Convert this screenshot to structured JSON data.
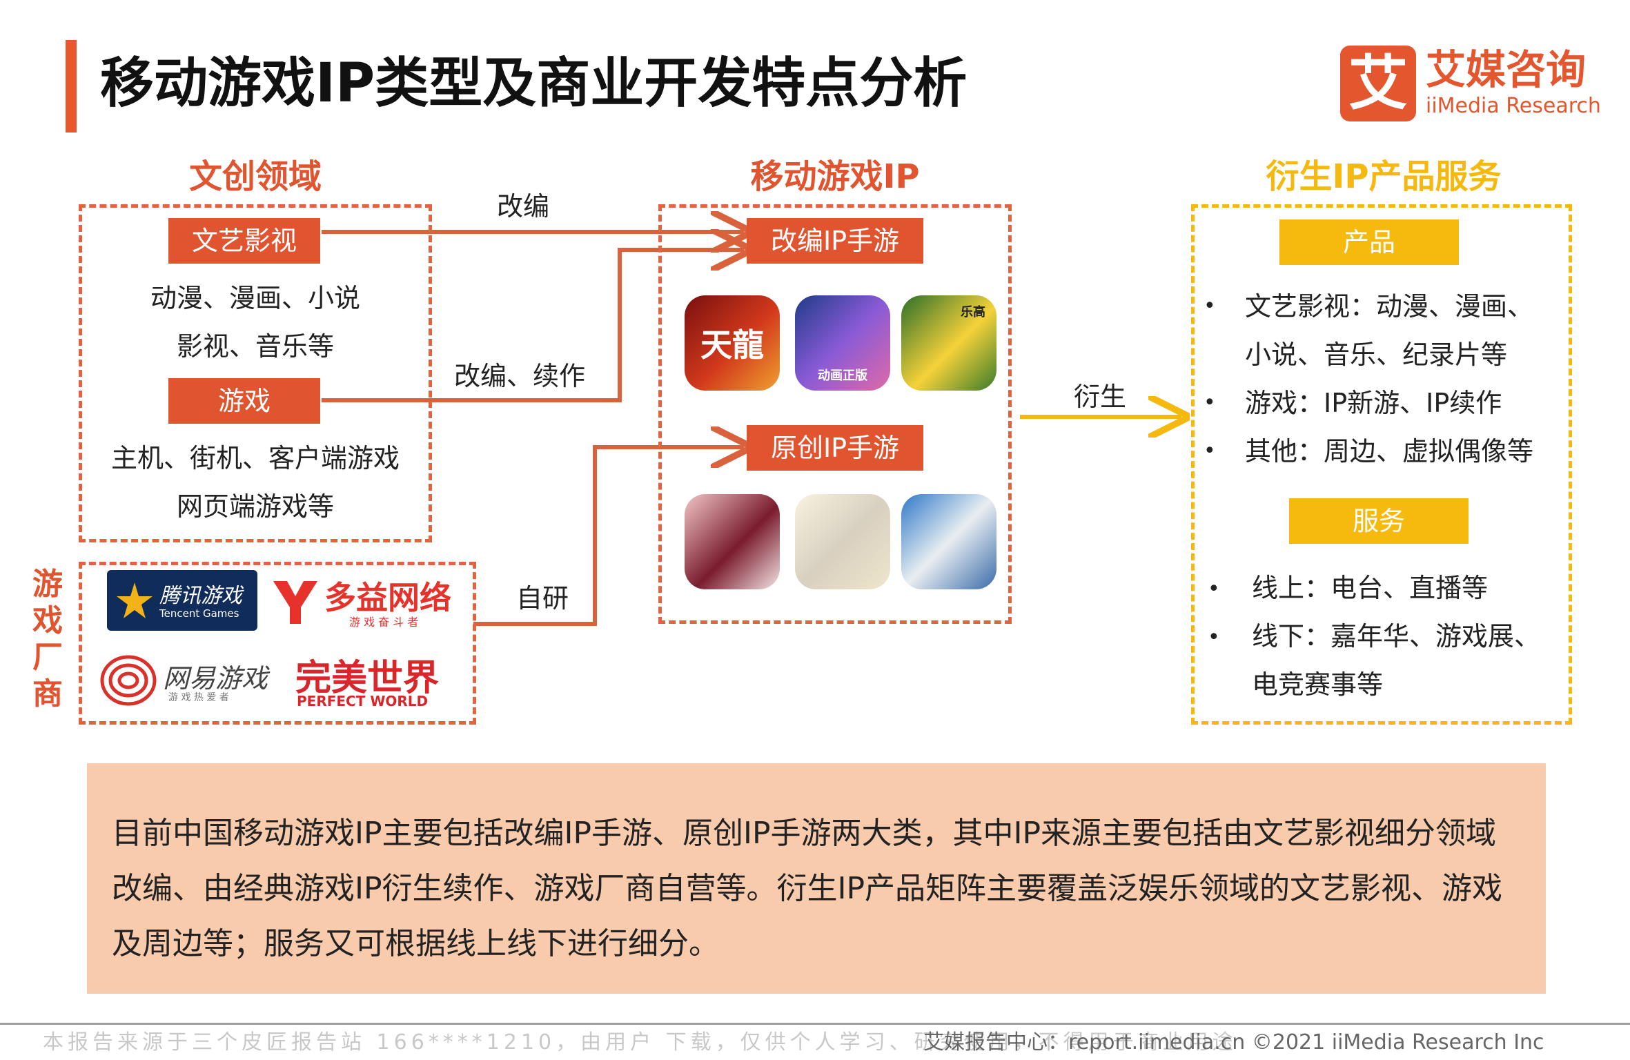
{
  "header": {
    "title": "移动游戏IP类型及商业开发特点分析",
    "logo_mark": "艾",
    "logo_cn": "艾媒咨询",
    "logo_en": "iiMedia Research"
  },
  "colors": {
    "accent_red": "#e0552f",
    "accent_yellow": "#f6b90e",
    "summary_bg": "#f8cbad"
  },
  "left": {
    "title": "文创领域",
    "tag1": "文艺影视",
    "tag1_lines": [
      "动漫、漫画、小说",
      "影视、音乐等"
    ],
    "tag2": "游戏",
    "tag2_lines": [
      "主机、街机、客户端游戏",
      "网页端游戏等"
    ]
  },
  "studios": {
    "label": "游戏厂商",
    "companies": [
      {
        "name": "腾讯游戏",
        "sub": "Tencent Games"
      },
      {
        "name": "多益网络",
        "sub": "游 戏 奋 斗 者"
      },
      {
        "name": "网易游戏",
        "sub": "游 戏 热 爱 者"
      },
      {
        "name": "完美世界",
        "sub": "PERFECT WORLD"
      }
    ]
  },
  "arrows": {
    "adapt": "改编",
    "adapt_sequel": "改编、续作",
    "self_dev": "自研",
    "derive": "衍生"
  },
  "middle": {
    "title": "移动游戏IP",
    "tag_adapted": "改编IP手游",
    "tag_original": "原创IP手游",
    "adapted_icons": [
      {
        "icon": "tianlong-game-icon",
        "text": "天龍"
      },
      {
        "icon": "anime-fighter-game-icon",
        "text": "动画正版"
      },
      {
        "icon": "lego-game-icon",
        "text": "乐高"
      }
    ],
    "original_icons": [
      {
        "icon": "onmyoji-girl-game-icon",
        "text": ""
      },
      {
        "icon": "white-hair-anime-game-icon",
        "text": ""
      },
      {
        "icon": "panda-game-icon",
        "text": ""
      }
    ]
  },
  "right": {
    "title": "衍生IP产品服务",
    "tag_product": "产品",
    "product_items": [
      "文艺影视：动漫、漫画、",
      "小说、音乐、纪录片等",
      "游戏：IP新游、IP续作",
      "其他：周边、虚拟偶像等"
    ],
    "tag_service": "服务",
    "service_items": [
      "线上：电台、直播等",
      "线下：嘉年华、游戏展、",
      "电竞赛事等"
    ]
  },
  "summary": "目前中国移动游戏IP主要包括改编IP手游、原创IP手游两大类，其中IP来源主要包括由文艺影视细分领域改编、由经典游戏IP衍生续作、游戏厂商自营等。衍生IP产品矩阵主要覆盖泛娱乐领域的文艺影视、游戏及周边等；服务又可根据线上线下进行细分。",
  "footer": {
    "left": "本报告来源于三个皮匠报告站 166****1210，由用户 下载，仅供个人学习、研究使用，不得用于商业用途",
    "right": "艾媒报告中心：report.iimedia.cn  ©2021  iiMedia Research  Inc"
  }
}
